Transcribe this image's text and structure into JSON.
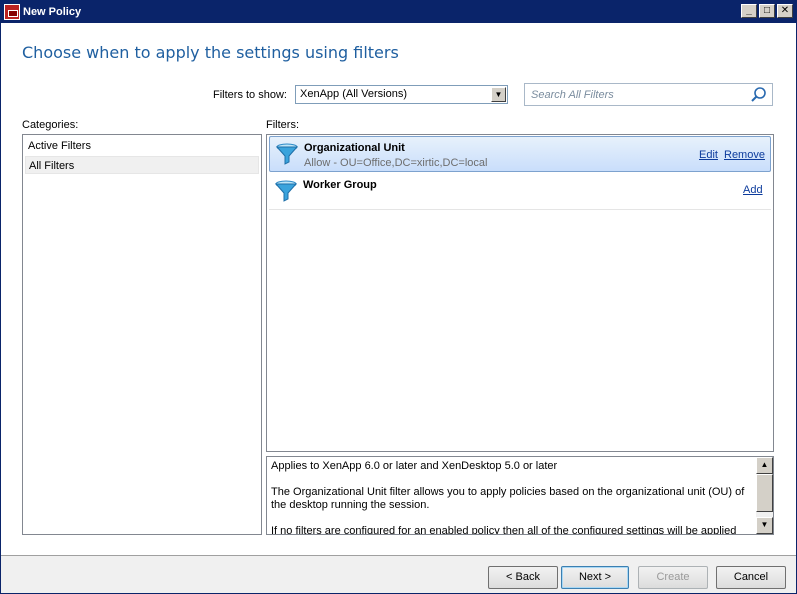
{
  "window": {
    "title": "New Policy",
    "controls": [
      "_",
      "□",
      "✕"
    ]
  },
  "heading": "Choose when to apply the settings using filters",
  "filters_to_show": {
    "label": "Filters to show:",
    "selected": "XenApp (All Versions)"
  },
  "search": {
    "placeholder": "Search All Filters",
    "icon": "search-icon"
  },
  "categories": {
    "label": "Categories:",
    "items": [
      {
        "label": "Active Filters",
        "selected": false
      },
      {
        "label": "All Filters",
        "selected": true
      }
    ]
  },
  "filters": {
    "label": "Filters:",
    "items": [
      {
        "name": "Organizational Unit",
        "description": "Allow - OU=Office,DC=xirtic,DC=local",
        "actions": [
          "Edit",
          "Remove"
        ],
        "selected": true,
        "icon": "funnel-icon"
      },
      {
        "name": "Worker Group",
        "description": "",
        "actions": [
          "Add"
        ],
        "selected": false,
        "icon": "funnel-icon"
      }
    ]
  },
  "description": {
    "line1": "Applies to XenApp 6.0 or later and XenDesktop 5.0 or later",
    "line2": "The Organizational Unit filter allows you to apply policies based on the organizational unit (OU) of the desktop running the session.",
    "line3": "If no filters are configured for an enabled policy then all of the configured settings will be applied"
  },
  "buttons": {
    "back": "< Back",
    "next": "Next >",
    "create": "Create",
    "cancel": "Cancel"
  },
  "colors": {
    "titlebar": "#0a246a",
    "heading": "#1f5fa0",
    "link": "#0c3b9c",
    "selection": "#c9defb"
  }
}
